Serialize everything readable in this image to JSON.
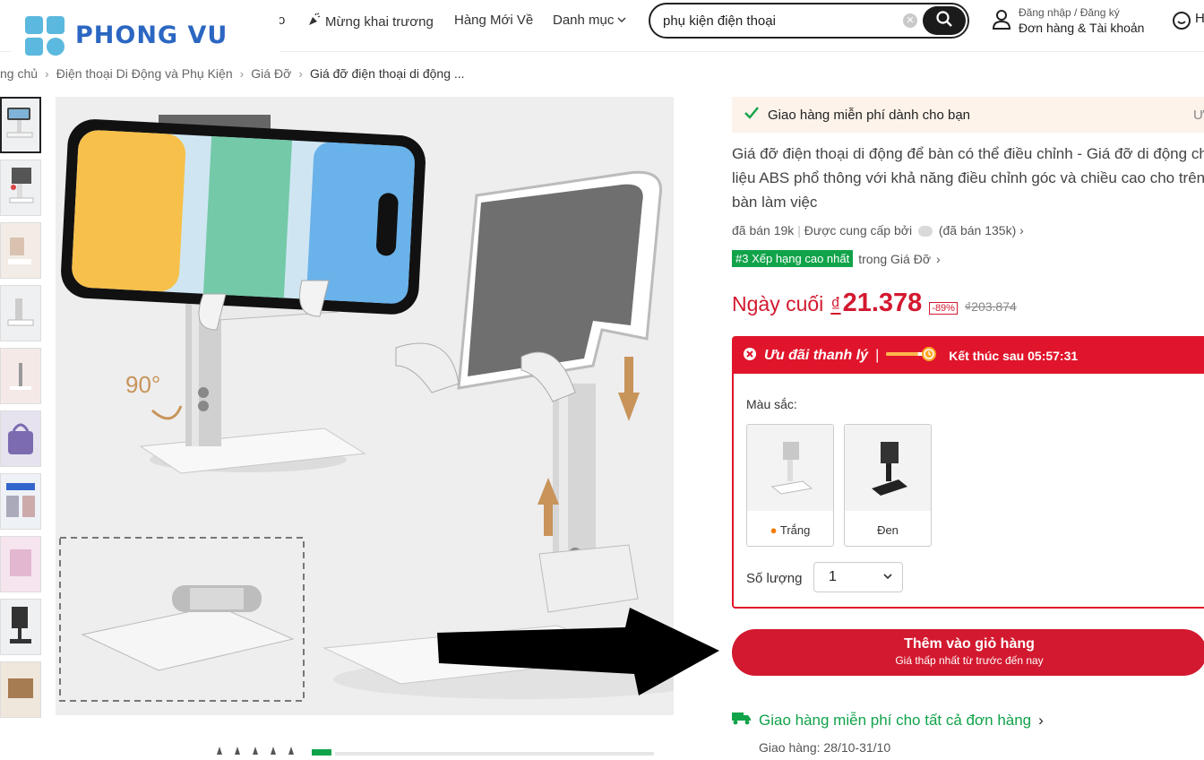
{
  "header": {
    "brand": "PHONG VU",
    "nav": [
      {
        "label": "o"
      },
      {
        "label": "Mừng khai trương"
      },
      {
        "label": "Hàng Mới Về"
      },
      {
        "label": "Danh mục"
      }
    ],
    "search": {
      "value": "phụ kiện điện thoại"
    },
    "account": {
      "line1": "Đăng nhập / Đăng ký",
      "line2": "Đơn hàng & Tài khoản"
    },
    "help_label": "H"
  },
  "breadcrumb": [
    "ng chủ",
    "Điện thoại Di Động và Phụ Kiện",
    "Giá Đỡ",
    "Giá đỡ điện thoại di động ..."
  ],
  "gallery": {
    "thumb_count": 10,
    "rotation_label": "90°"
  },
  "product": {
    "ship_banner": "Giao hàng miễn phí dành cho bạn",
    "ship_banner_more": "Ư",
    "title": "Giá đỡ điện thoại di động để bàn có thể điều chỉnh - Giá đỡ di động chất liệu ABS phổ thông với khả năng điều chỉnh góc và chiều cao cho trên bàn làm việc",
    "sold": "đã bán 19k",
    "provider": "Được cung cấp bởi",
    "provider_sold": "(đã bán 135k)",
    "rank_badge": "#3 Xếp hạng cao nhất",
    "rank_context": "trong Giá Đỡ",
    "price_label": "Ngày cuối",
    "currency": "₫",
    "price": "21.378",
    "discount": "-89%",
    "old_price": "₫203.874"
  },
  "deal": {
    "title": "Ưu đãi thanh lý",
    "timer": "Kết thúc sau 05:57:31",
    "color_label": "Màu sắc:",
    "options": [
      {
        "label": "Trắng",
        "color": "#ffffff"
      },
      {
        "label": "Đen",
        "color": "#222222"
      }
    ],
    "qty_label": "Số lượng",
    "qty_value": "1"
  },
  "cart": {
    "label": "Thêm vào giỏ hàng",
    "sub": "Giá thấp nhất từ trước đến nay"
  },
  "shipping": {
    "free_all": "Giao hàng miễn phí cho tất cả đơn hàng",
    "delivery": "Giao hàng: 28/10-31/10"
  },
  "colors": {
    "brand_blue": "#2b67c2",
    "logo_cyan": "#5bb8de",
    "accent_red": "#d3192f",
    "green": "#11a34a"
  }
}
